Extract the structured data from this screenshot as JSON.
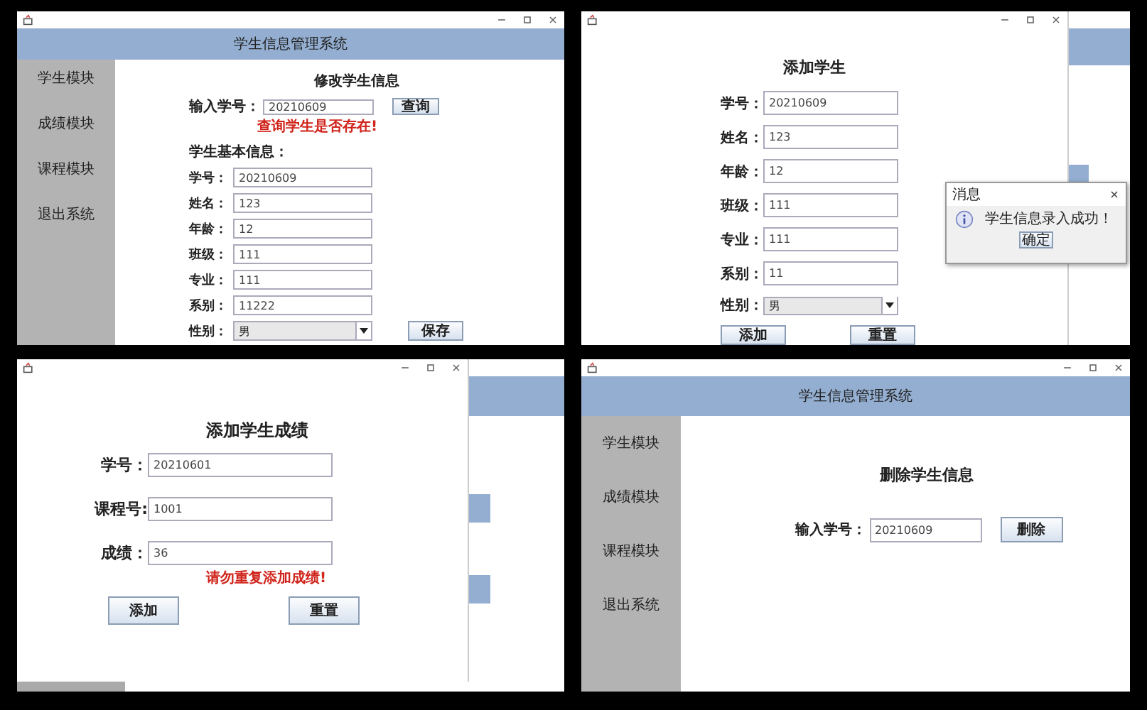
{
  "edit_student_window": {
    "header_title": "学生信息管理系统",
    "sidebar": [
      "学生模块",
      "成绩模块",
      "课程模块",
      "退出系统"
    ],
    "form_title": "修改学生信息",
    "query": {
      "label": "输入学号：",
      "value": "20210609",
      "button": "查询"
    },
    "warning": "查询学生是否存在!",
    "section_title": "学生基本信息：",
    "fields": [
      {
        "kind": "text",
        "label": "学号：",
        "value": "20210609"
      },
      {
        "kind": "text",
        "label": "姓名：",
        "value": "123"
      },
      {
        "kind": "text",
        "label": "年龄：",
        "value": "12"
      },
      {
        "kind": "text",
        "label": "班级：",
        "value": "111"
      },
      {
        "kind": "text",
        "label": "专业：",
        "value": "111"
      },
      {
        "kind": "text",
        "label": "系别：",
        "value": "11222"
      },
      {
        "kind": "dropdown",
        "label": "性别：",
        "value": "男"
      }
    ],
    "save_button": "保存"
  },
  "add_student_window": {
    "form_title": "添加学生",
    "fields": [
      {
        "kind": "text",
        "label": "学号：",
        "value": "20210609"
      },
      {
        "kind": "text",
        "label": "姓名：",
        "value": "123"
      },
      {
        "kind": "text",
        "label": "年龄：",
        "value": "12"
      },
      {
        "kind": "text",
        "label": "班级：",
        "value": "111"
      },
      {
        "kind": "text",
        "label": "专业：",
        "value": "111"
      },
      {
        "kind": "text",
        "label": "系别：",
        "value": "11"
      },
      {
        "kind": "dropdown",
        "label": "性别：",
        "value": "男"
      }
    ],
    "buttons": [
      "添加",
      "重置"
    ],
    "dialog": {
      "title": "消息",
      "message": "学生信息录入成功！",
      "button": "确定"
    }
  },
  "add_score_window": {
    "form_title": "添加学生成绩",
    "fields": [
      {
        "label": "学号：",
        "value": "20210601"
      },
      {
        "label": "课程号:",
        "value": "1001"
      },
      {
        "label": "成绩：",
        "value": "36"
      }
    ],
    "warning": "请勿重复添加成绩!",
    "buttons": [
      "添加",
      "重置"
    ]
  },
  "delete_student_window": {
    "header_title": "学生信息管理系统",
    "sidebar": [
      "学生模块",
      "成绩模块",
      "课程模块",
      "退出系统"
    ],
    "form_title": "删除学生信息",
    "query": {
      "label": "输入学号：",
      "value": "20210609",
      "button": "删除"
    }
  }
}
